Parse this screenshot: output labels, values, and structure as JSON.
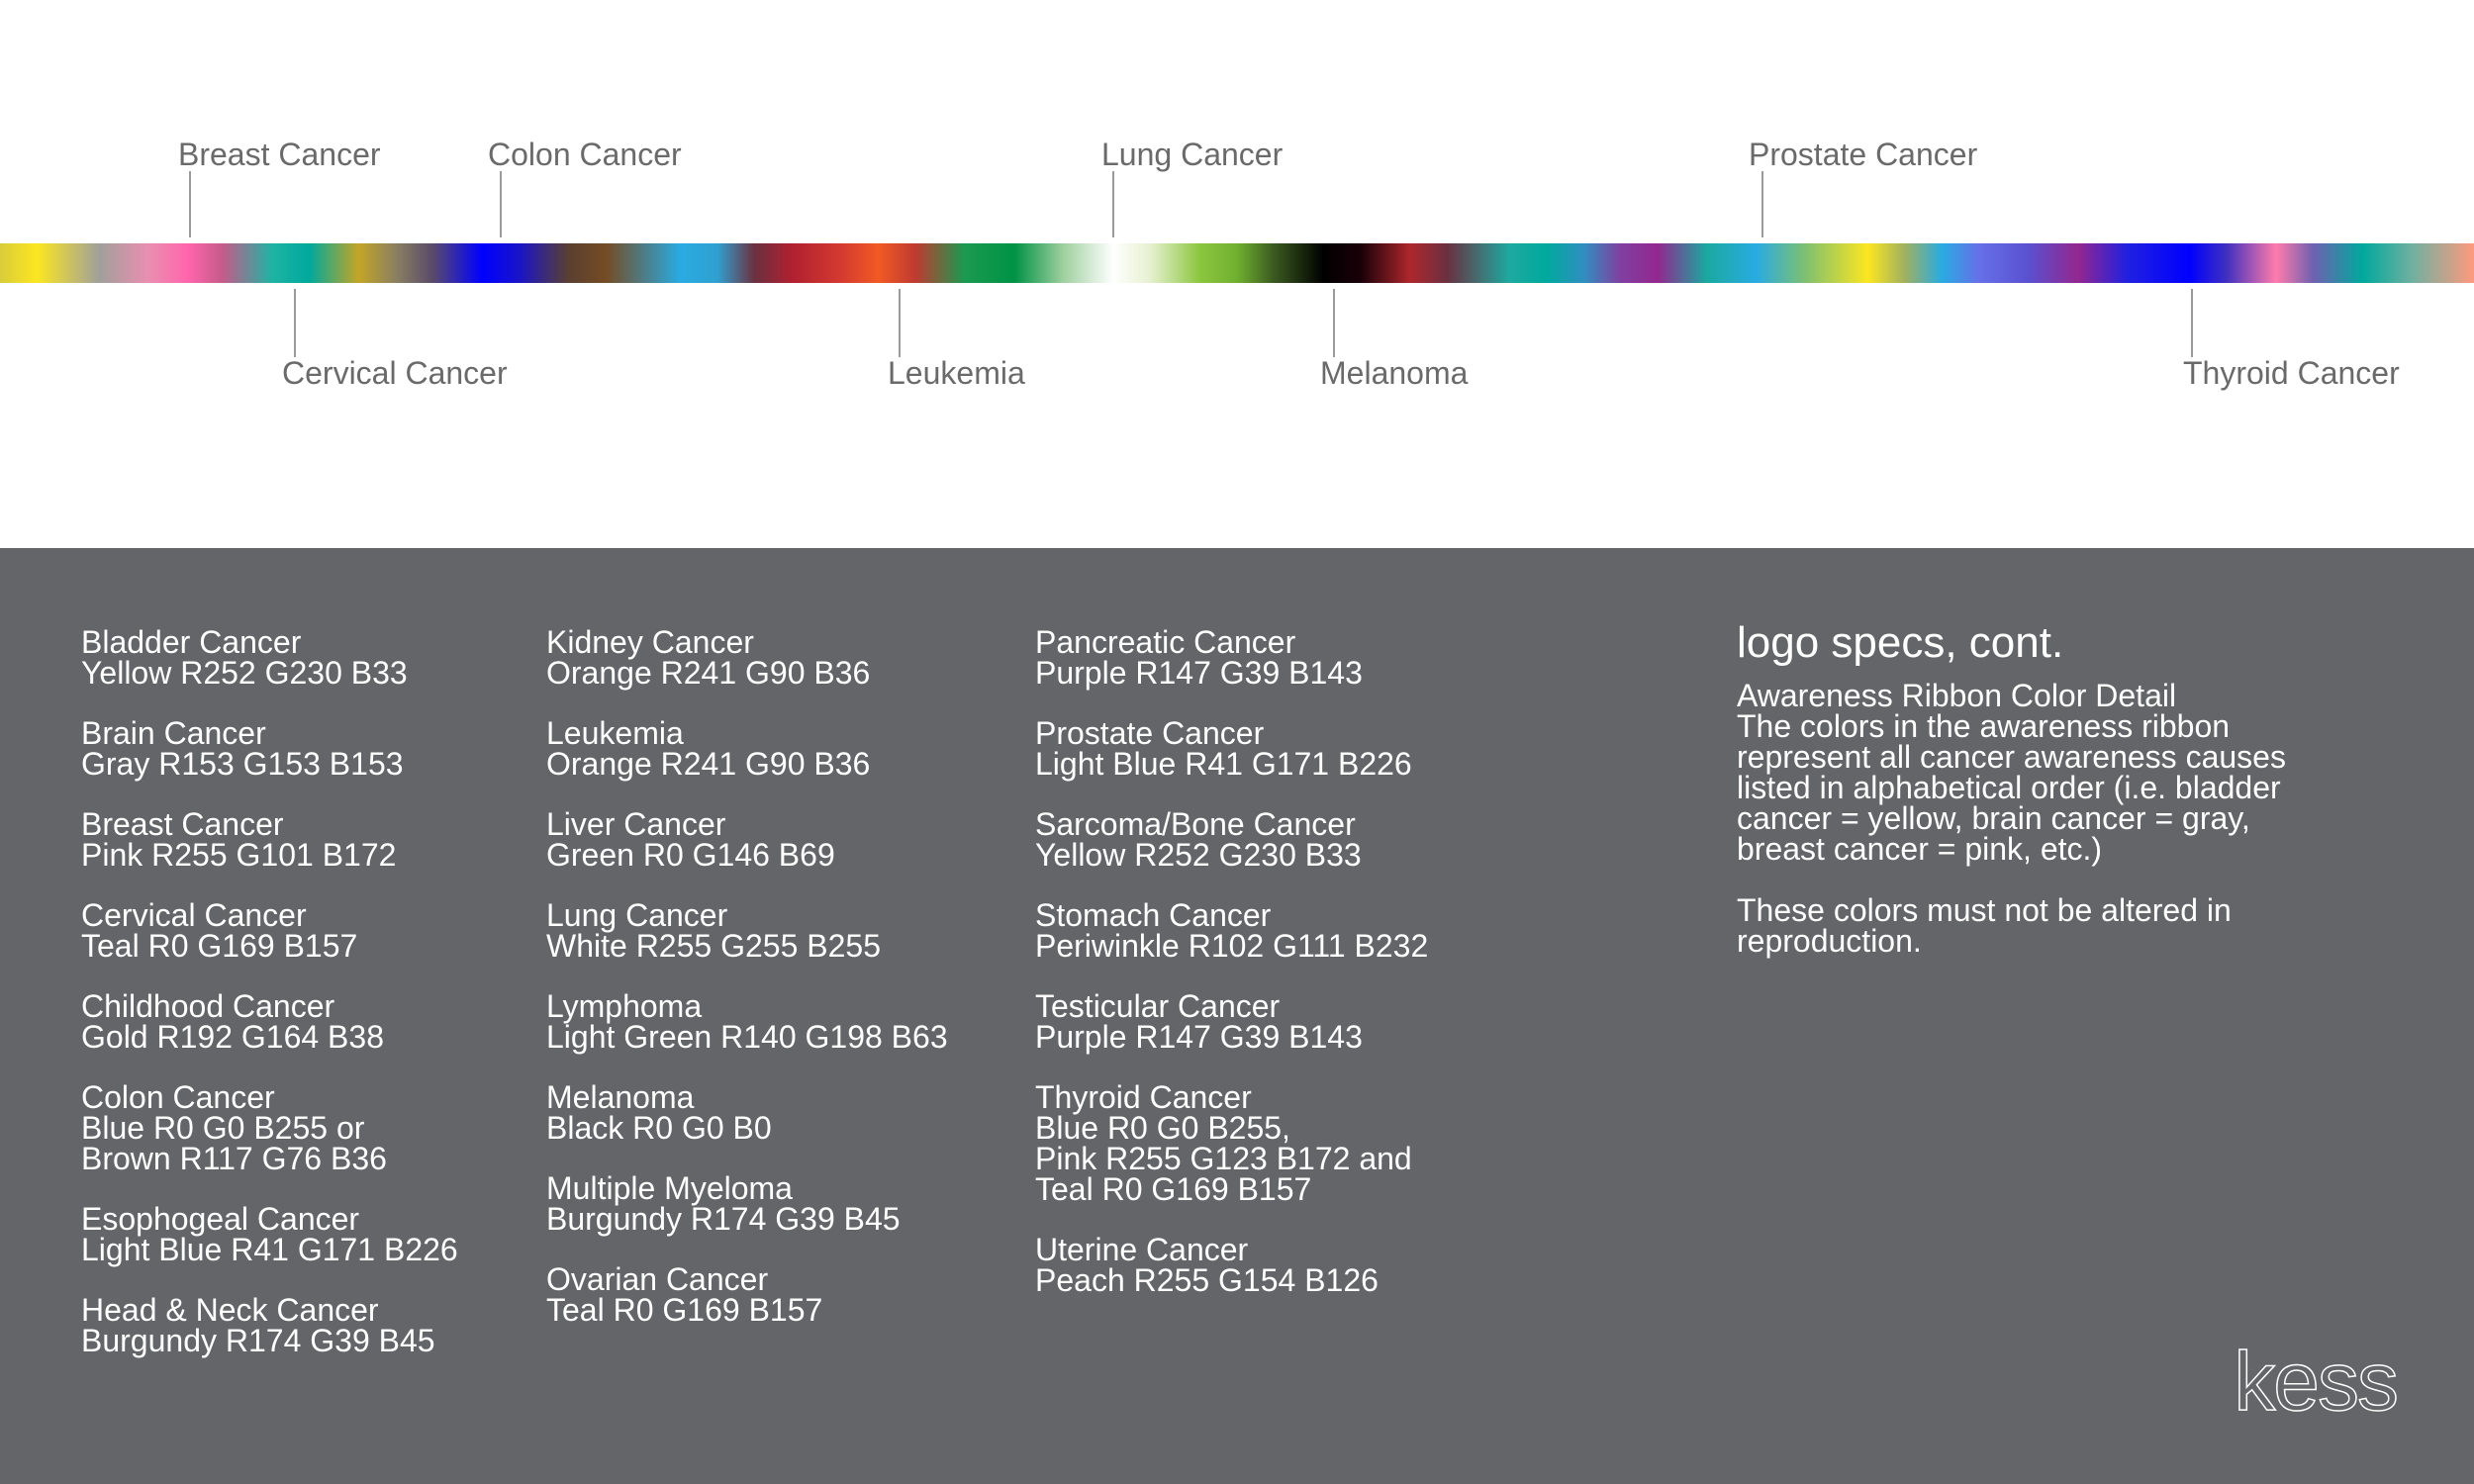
{
  "ribbon": {
    "labels_top": [
      {
        "text": "Breast Cancer"
      },
      {
        "text": "Colon Cancer"
      },
      {
        "text": "Lung Cancer"
      },
      {
        "text": "Prostate Cancer"
      }
    ],
    "labels_bottom": [
      {
        "text": "Cervical Cancer"
      },
      {
        "text": "Leukemia"
      },
      {
        "text": "Melanoma"
      },
      {
        "text": "Thyroid Cancer"
      }
    ]
  },
  "colors": {
    "panel_bg": "#646569",
    "label_gray": "#6a6a6a"
  },
  "columns": [
    [
      {
        "name": "Bladder Cancer",
        "lines": [
          "Yellow R252 G230 B33"
        ]
      },
      {
        "name": "Brain Cancer",
        "lines": [
          "Gray R153 G153 B153"
        ]
      },
      {
        "name": "Breast Cancer",
        "lines": [
          "Pink R255 G101 B172"
        ]
      },
      {
        "name": "Cervical Cancer",
        "lines": [
          "Teal R0 G169 B157"
        ]
      },
      {
        "name": "Childhood Cancer",
        "lines": [
          "Gold R192 G164 B38"
        ]
      },
      {
        "name": "Colon Cancer",
        "lines": [
          "Blue R0 G0 B255 or",
          "Brown R117 G76 B36"
        ]
      },
      {
        "name": "Esophogeal Cancer",
        "lines": [
          "Light Blue R41 G171 B226"
        ]
      },
      {
        "name": "Head & Neck Cancer",
        "lines": [
          "Burgundy R174 G39 B45"
        ]
      }
    ],
    [
      {
        "name": "Kidney Cancer",
        "lines": [
          "Orange R241 G90 B36"
        ]
      },
      {
        "name": "Leukemia",
        "lines": [
          "Orange R241 G90 B36"
        ]
      },
      {
        "name": "Liver Cancer",
        "lines": [
          "Green R0 G146 B69"
        ]
      },
      {
        "name": "Lung Cancer",
        "lines": [
          "White R255 G255 B255"
        ]
      },
      {
        "name": "Lymphoma",
        "lines": [
          "Light Green R140 G198 B63"
        ]
      },
      {
        "name": "Melanoma",
        "lines": [
          "Black R0 G0 B0"
        ]
      },
      {
        "name": "Multiple Myeloma",
        "lines": [
          "Burgundy R174 G39 B45"
        ]
      },
      {
        "name": "Ovarian Cancer",
        "lines": [
          "Teal R0 G169 B157"
        ]
      }
    ],
    [
      {
        "name": "Pancreatic Cancer",
        "lines": [
          "Purple R147 G39 B143"
        ]
      },
      {
        "name": "Prostate Cancer",
        "lines": [
          "Light Blue R41 G171 B226"
        ]
      },
      {
        "name": "Sarcoma/Bone Cancer",
        "lines": [
          "Yellow R252 G230 B33"
        ]
      },
      {
        "name": "Stomach Cancer",
        "lines": [
          "Periwinkle R102 G111 B232"
        ]
      },
      {
        "name": "Testicular Cancer",
        "lines": [
          "Purple R147 G39 B143"
        ]
      },
      {
        "name": "Thyroid Cancer",
        "lines": [
          "Blue R0 G0 B255,",
          "Pink R255 G123 B172 and",
          "Teal R0 G169 B157"
        ]
      },
      {
        "name": "Uterine Cancer",
        "lines": [
          "Peach R255 G154 B126"
        ]
      }
    ]
  ],
  "specs": {
    "title": "logo specs, cont.",
    "paragraph1": [
      "Awareness Ribbon Color Detail",
      "The colors in the awareness ribbon",
      "represent all cancer awareness causes",
      "listed in alphabetical order (i.e. bladder",
      "cancer = yellow, brain cancer = gray,",
      "breast cancer = pink, etc.)"
    ],
    "paragraph2": [
      "These colors must not be altered in",
      "reproduction."
    ]
  },
  "brand": {
    "logo_text": "kess"
  }
}
